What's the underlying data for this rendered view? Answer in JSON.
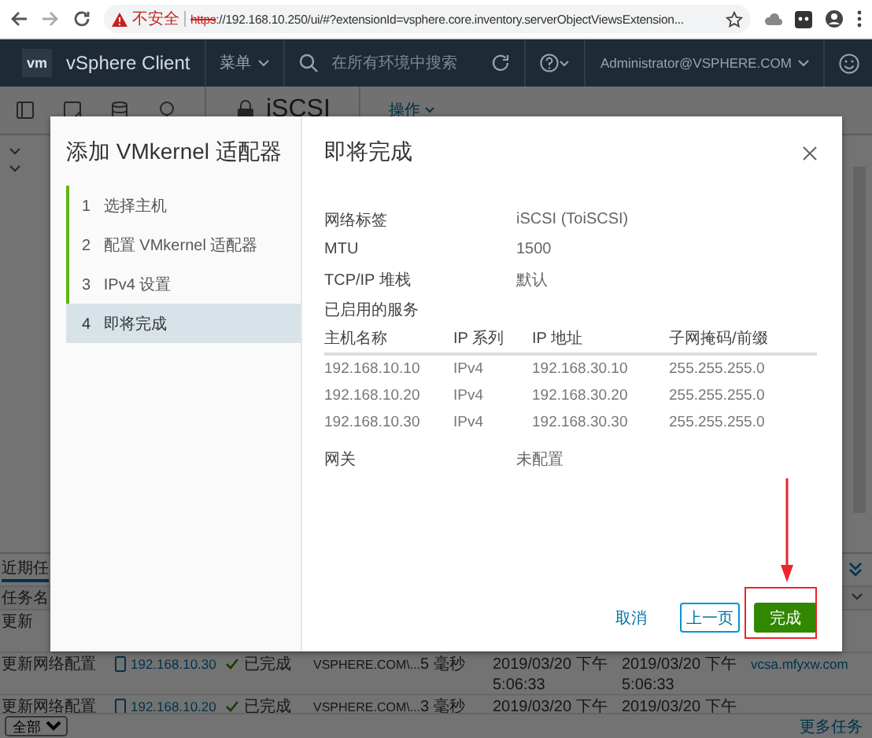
{
  "browser": {
    "warning": "不安全",
    "url_scheme": "https",
    "url_rest": "://192.168.10.250/ui/#?extensionId=vsphere.core.inventory.serverObjectViewsExtension..."
  },
  "header": {
    "logo": "vm",
    "product": "vSphere Client",
    "menu": "菜单",
    "search_placeholder": "在所有环境中搜索",
    "user": "Administrator@VSPHERE.COM"
  },
  "object": {
    "title": "iSCSI",
    "actions": "操作"
  },
  "tasks": {
    "tab": "近期任",
    "column": "任务名",
    "rows": [
      {
        "name": "更新"
      },
      {
        "name": "更新网络配置",
        "target": "192.168.10.30",
        "status": "已完成",
        "initiator": "VSPHERE.COM\\...",
        "duration": "5 毫秒",
        "queued": "2019/03/20 下午 5:06:33",
        "start": "2019/03/20 下午 5:06:33",
        "server": "vcsa.mfyxw.com"
      },
      {
        "name": "更新网络配置",
        "target": "192.168.10.20",
        "status": "已完成",
        "initiator": "VSPHERE.COM\\...",
        "duration": "3 毫秒",
        "queued": "2019/03/20 下午",
        "start": "2019/03/20 下午"
      }
    ],
    "filter": "全部",
    "more": "更多任务"
  },
  "dialog": {
    "title": "添加 VMkernel 适配器",
    "steps": [
      {
        "number": "1",
        "label": "选择主机",
        "completed": true,
        "selected": false
      },
      {
        "number": "2",
        "label": "配置 VMkernel 适配器",
        "completed": true,
        "selected": false
      },
      {
        "number": "3",
        "label": "IPv4 设置",
        "completed": true,
        "selected": false
      },
      {
        "number": "4",
        "label": "即将完成",
        "completed": false,
        "selected": true
      }
    ],
    "page_title": "即将完成",
    "properties": [
      {
        "label": "网络标签",
        "value": "iSCSI (ToiSCSI)"
      },
      {
        "label": "MTU",
        "value": "1500"
      },
      {
        "label": "TCP/IP 堆栈",
        "value": "默认"
      },
      {
        "label": "已启用的服务"
      }
    ],
    "table": {
      "columns": [
        "主机名称",
        "IP 系列",
        "IP 地址",
        "子网掩码/前缀"
      ],
      "rows": [
        [
          "192.168.10.10",
          "IPv4",
          "192.168.30.10",
          "255.255.255.0"
        ],
        [
          "192.168.10.20",
          "IPv4",
          "192.168.30.20",
          "255.255.255.0"
        ],
        [
          "192.168.10.30",
          "IPv4",
          "192.168.30.30",
          "255.255.255.0"
        ]
      ]
    },
    "gateway": {
      "label": "网关",
      "value": "未配置"
    },
    "buttons": {
      "cancel": "取消",
      "back": "上一页",
      "finish": "完成"
    }
  }
}
